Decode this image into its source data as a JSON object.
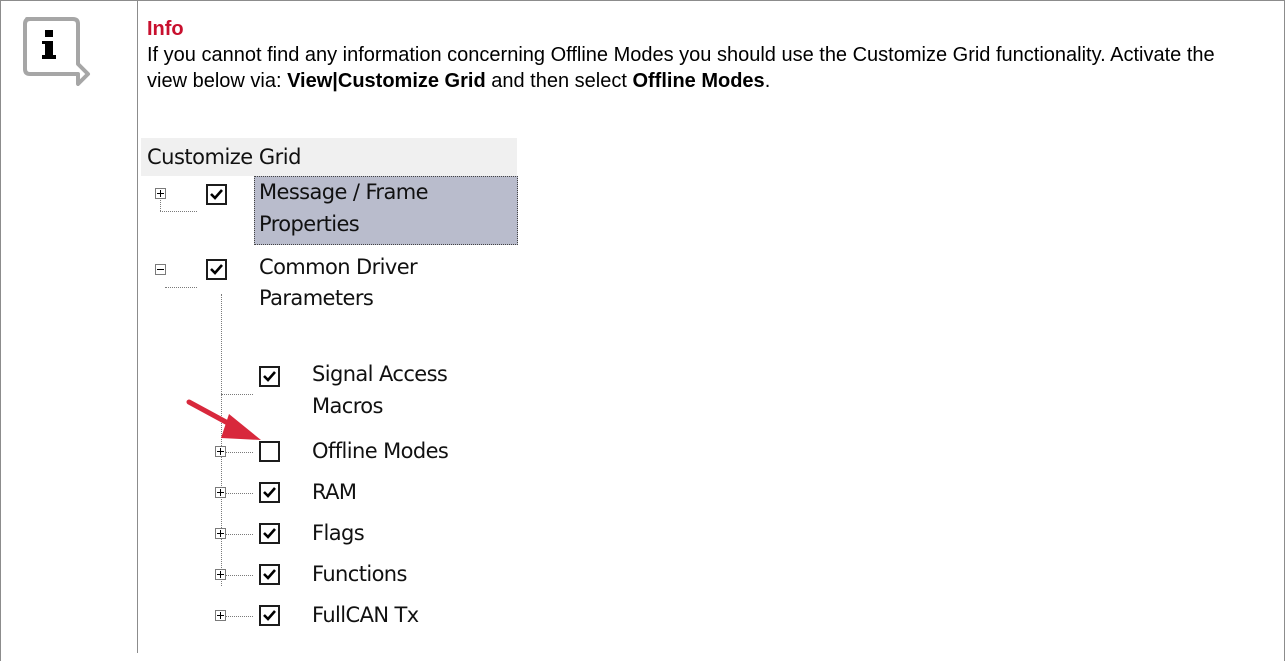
{
  "info": {
    "title": "Info",
    "body_parts": [
      {
        "text": "If you cannot find any information concerning Offline Modes you should use the Customize Grid functionality. Activate the view below via: ",
        "bold": false
      },
      {
        "text": "View|Customize Grid",
        "bold": true
      },
      {
        "text": " and then select ",
        "bold": false
      },
      {
        "text": "Offline Modes",
        "bold": true
      },
      {
        "text": ".",
        "bold": false
      }
    ],
    "accent_color": "#c8102e"
  },
  "customize_grid": {
    "title": "Customize Grid",
    "nodes": [
      {
        "line1": "Message / Frame",
        "line2": "Properties",
        "checked": true,
        "expander": "plus",
        "selected": true
      },
      {
        "line1": "Common Driver",
        "line2": "Parameters",
        "checked": true,
        "expander": "minus",
        "selected": false
      },
      {
        "line1": "Signal Access",
        "line2": "Macros",
        "checked": true,
        "expander": "none",
        "selected": false
      },
      {
        "line1": "Offline Modes",
        "checked": false,
        "expander": "plus",
        "selected": false
      },
      {
        "line1": "RAM",
        "checked": true,
        "expander": "plus",
        "selected": false
      },
      {
        "line1": "Flags",
        "checked": true,
        "expander": "plus",
        "selected": false
      },
      {
        "line1": "Functions",
        "checked": true,
        "expander": "plus",
        "selected": false
      },
      {
        "line1": "FullCAN Tx",
        "checked": true,
        "expander": "plus",
        "selected": false
      }
    ],
    "selection_color": "#b9bccc",
    "pointer_arrow_color": "#d8283c"
  }
}
